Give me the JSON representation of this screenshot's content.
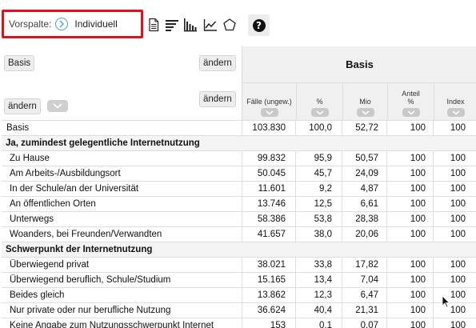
{
  "toolbar": {
    "vorspalte_label": "Vorspalte:",
    "vorspalte_value": "Individuell",
    "icons": [
      "document-icon",
      "sort-lines-icon",
      "bar-chart-icon",
      "line-chart-icon",
      "pentagon-icon"
    ],
    "help_label": "?"
  },
  "header": {
    "basis_button": "Basis",
    "aendern_top": "ändern",
    "aendern_bottom_left": "ändern",
    "aendern_bottom_right": "ändern",
    "column_group_title": "Basis",
    "columns": [
      {
        "label": "Fälle (ungew.)"
      },
      {
        "label": "%"
      },
      {
        "label": "Mio"
      },
      {
        "label": "Anteil %"
      },
      {
        "label": "Index"
      }
    ]
  },
  "rows": [
    {
      "label": "Basis",
      "type": "plain",
      "values": [
        "103.830",
        "100,0",
        "52,72",
        "100",
        "100"
      ]
    },
    {
      "label": "Ja, zumindest gelegentliche Internetnutzung",
      "type": "section",
      "values": []
    },
    {
      "label": "Zu Hause",
      "type": "indent",
      "values": [
        "99.832",
        "95,9",
        "50,57",
        "100",
        "100"
      ]
    },
    {
      "label": "Am Arbeits-/Ausbildungsort",
      "type": "indent",
      "values": [
        "50.045",
        "45,7",
        "24,09",
        "100",
        "100"
      ]
    },
    {
      "label": "In der Schule/an der Universität",
      "type": "indent",
      "values": [
        "11.601",
        "9,2",
        "4,87",
        "100",
        "100"
      ]
    },
    {
      "label": "An öffentlichen Orten",
      "type": "indent",
      "values": [
        "13.746",
        "12,5",
        "6,61",
        "100",
        "100"
      ]
    },
    {
      "label": "Unterwegs",
      "type": "indent",
      "values": [
        "58.386",
        "53,8",
        "28,38",
        "100",
        "100"
      ]
    },
    {
      "label": "Woanders, bei Freunden/Verwandten",
      "type": "indent",
      "values": [
        "41.657",
        "38,0",
        "20,06",
        "100",
        "100"
      ]
    },
    {
      "label": "Schwerpunkt der Internetnutzung",
      "type": "section",
      "values": []
    },
    {
      "label": "Überwiegend privat",
      "type": "indent",
      "values": [
        "38.021",
        "33,8",
        "17,82",
        "100",
        "100"
      ]
    },
    {
      "label": "Überwiegend beruflich, Schule/Studium",
      "type": "indent",
      "values": [
        "15.165",
        "13,4",
        "7,04",
        "100",
        "100"
      ]
    },
    {
      "label": "Beides gleich",
      "type": "indent",
      "values": [
        "13.862",
        "12,3",
        "6,47",
        "100",
        "100"
      ]
    },
    {
      "label": "Nur private oder nur berufliche Nutzung",
      "type": "indent",
      "values": [
        "36.624",
        "40,4",
        "21,31",
        "100",
        "100"
      ]
    },
    {
      "label": "Keine Angabe zum Nutzungsschwerpunkt Internet",
      "type": "indent",
      "values": [
        "153",
        "0,1",
        "0,07",
        "100",
        "100"
      ]
    }
  ],
  "colors": {
    "highlight_border": "#e0101d",
    "accent_circle": "#4a9fd8",
    "header_bg": "#f0f0f0"
  }
}
